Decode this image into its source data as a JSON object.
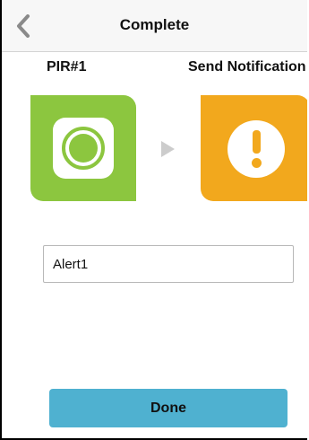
{
  "nav": {
    "title": "Complete",
    "back_icon": "chevron-left-icon"
  },
  "trigger": {
    "label": "PIR#1",
    "icon": "motion-sensor-icon",
    "color": "#8cc63f"
  },
  "flow_arrow_icon": "play-arrow-icon",
  "action": {
    "label": "Send Notification",
    "icon": "alert-exclamation-icon",
    "color": "#f2a81d"
  },
  "name_field": {
    "value": "Alert1",
    "placeholder": ""
  },
  "done_button": {
    "label": "Done",
    "color": "#4fb1d0"
  }
}
